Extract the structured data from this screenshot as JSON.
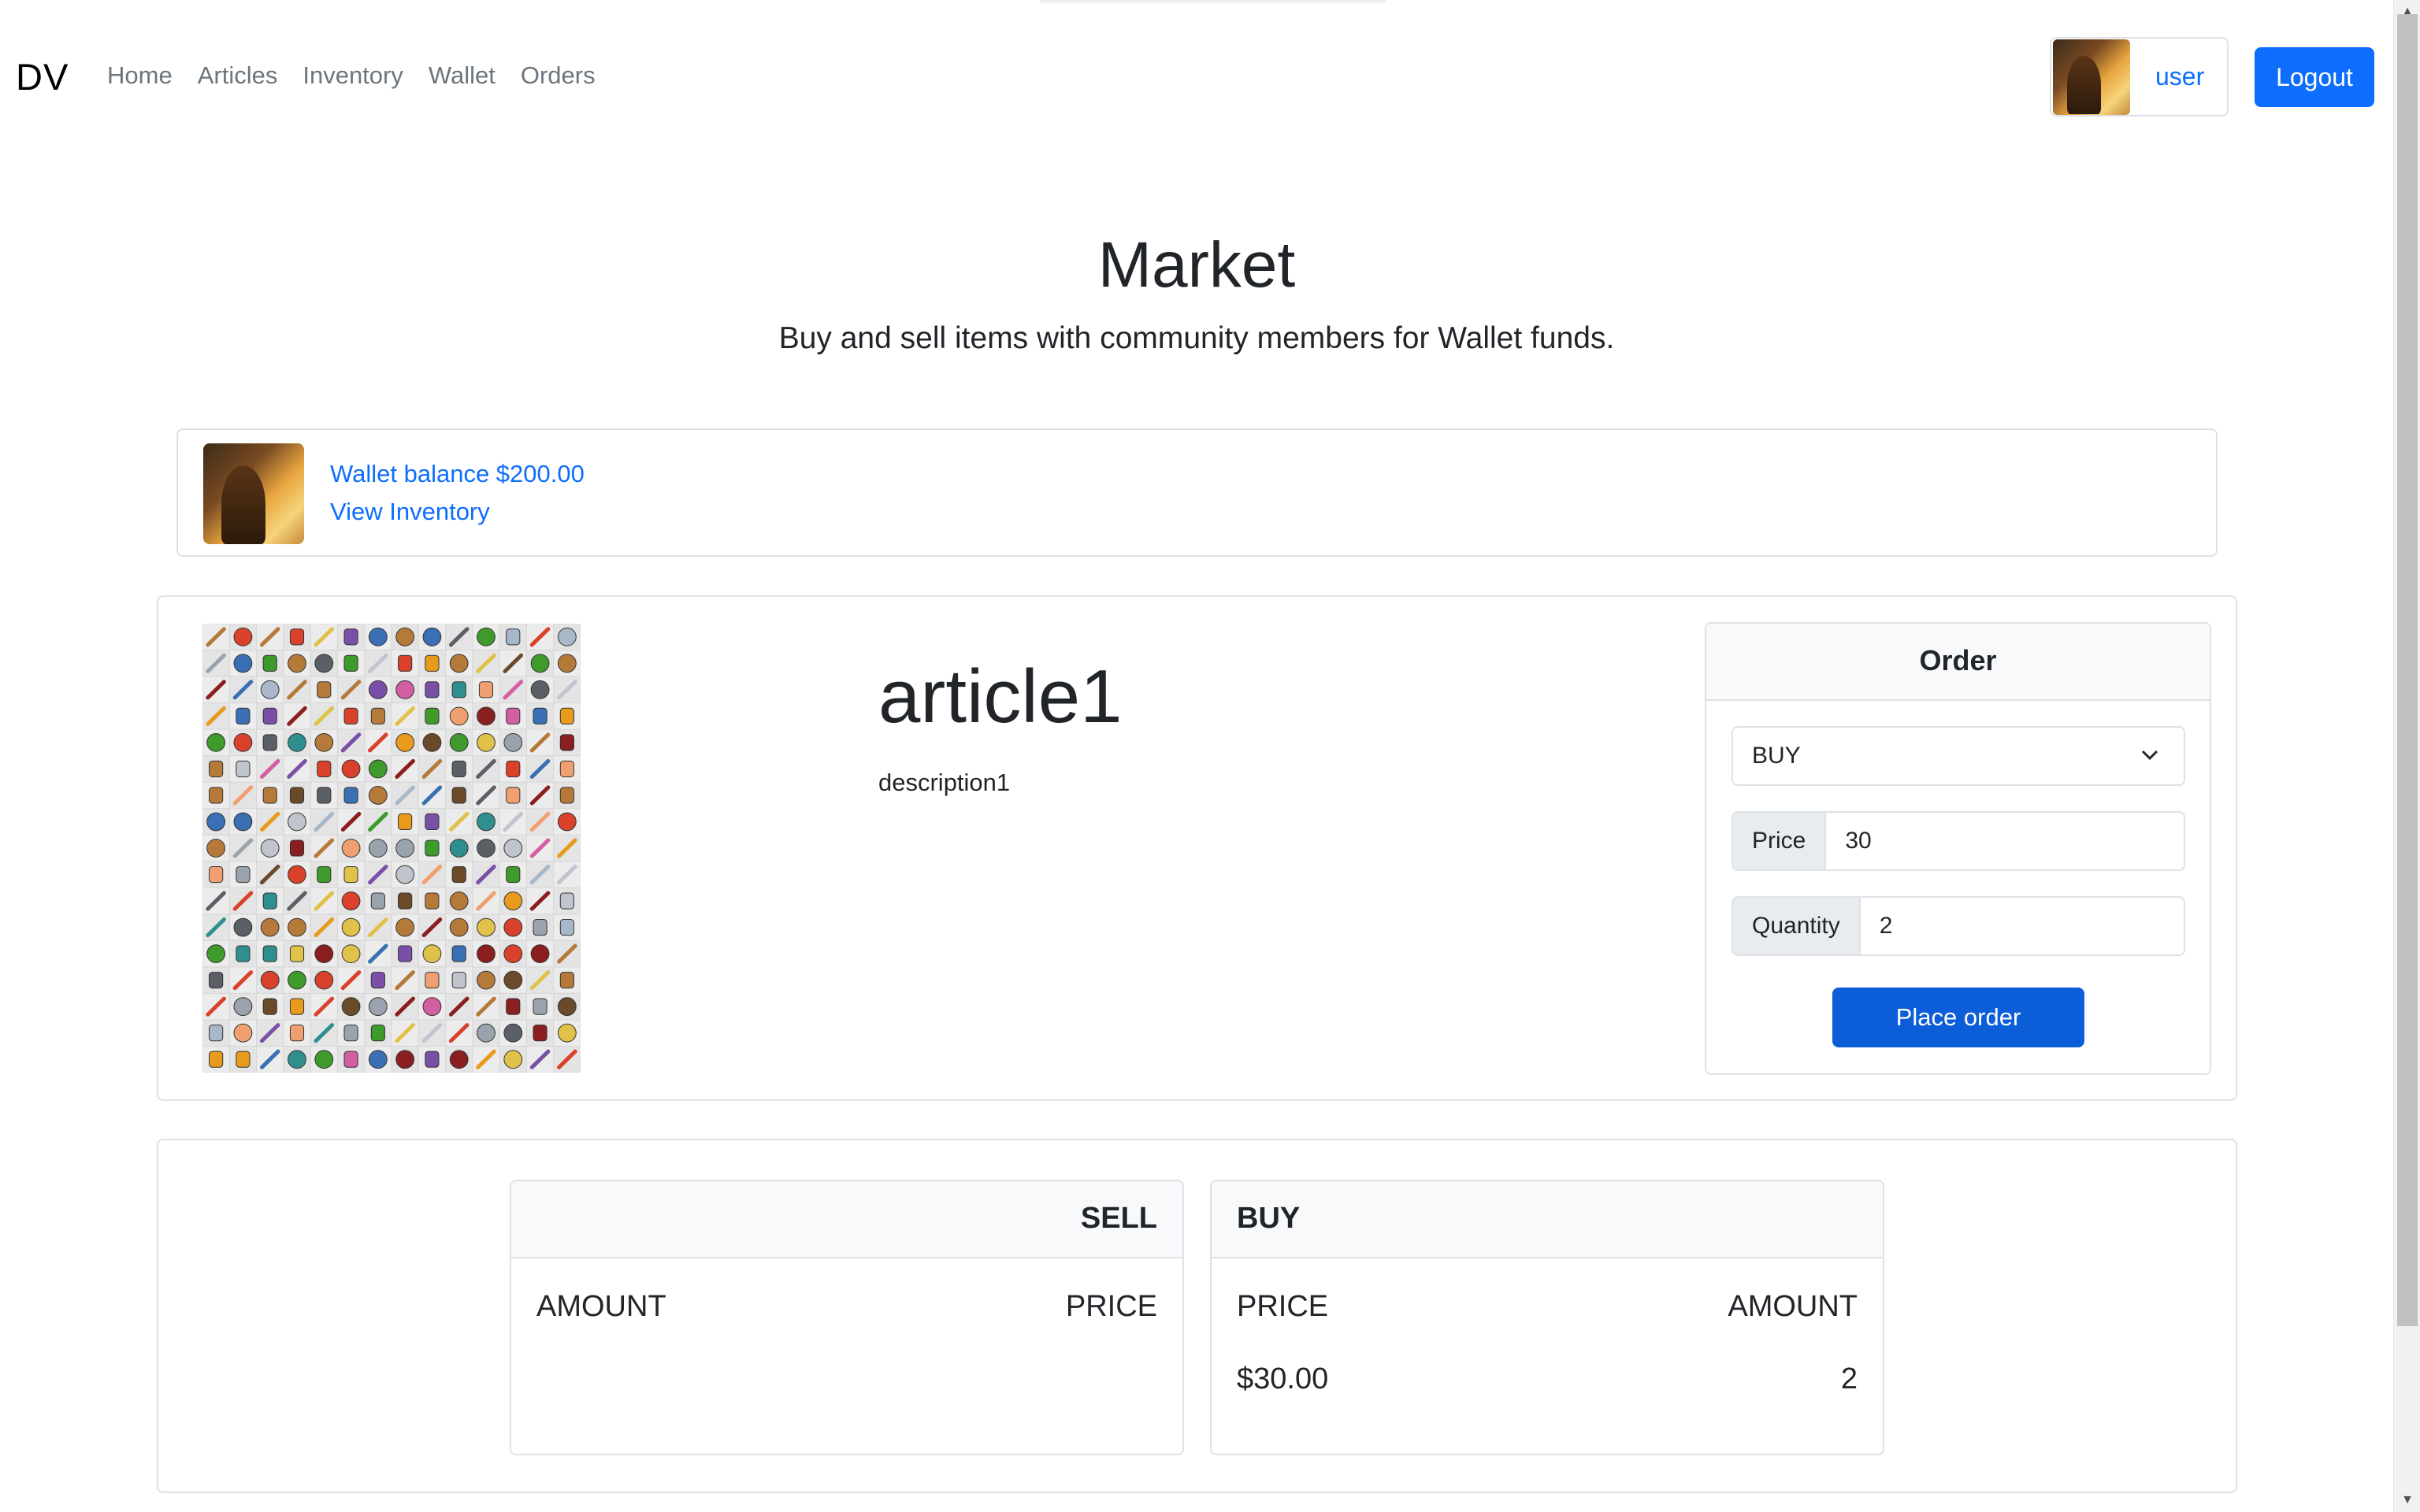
{
  "nav": {
    "brand": "DV",
    "links": [
      "Home",
      "Articles",
      "Inventory",
      "Wallet",
      "Orders"
    ],
    "user": "user",
    "logout": "Logout"
  },
  "hero": {
    "title": "Market",
    "subtitle": "Buy and sell items with community members for Wallet funds."
  },
  "wallet": {
    "balance_text": "Wallet balance $200.00",
    "inventory_link": "View Inventory"
  },
  "article": {
    "title": "article1",
    "description": "description1"
  },
  "order": {
    "header": "Order",
    "side": "BUY",
    "price_label": "Price",
    "price_value": "30",
    "quantity_label": "Quantity",
    "quantity_value": "2",
    "submit": "Place order"
  },
  "book": {
    "sell": {
      "header": "SELL",
      "col_left": "AMOUNT",
      "col_right": "PRICE",
      "rows": []
    },
    "buy": {
      "header": "BUY",
      "col_left": "PRICE",
      "col_right": "AMOUNT",
      "rows": [
        {
          "price": "$30.00",
          "amount": "2"
        }
      ]
    }
  },
  "icons": {
    "chevron": "chevron-down-icon",
    "sprite": "item-sprite-sheet"
  },
  "colors": {
    "primary": "#0d6efd",
    "primary_dark": "#0b5ed7",
    "muted": "#6c757d",
    "border": "#dee2e6"
  }
}
